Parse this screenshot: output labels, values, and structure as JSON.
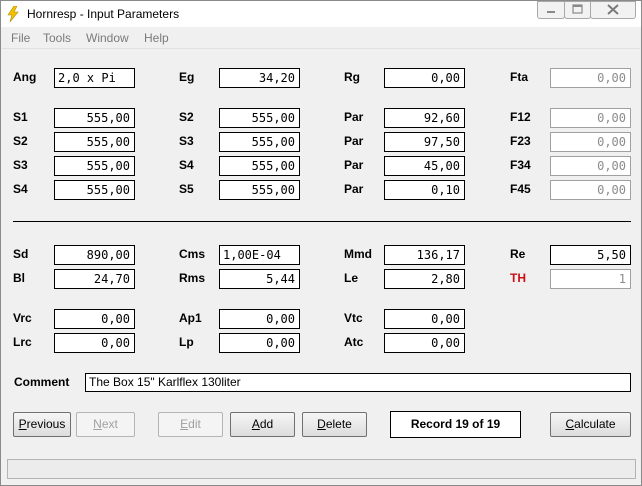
{
  "window": {
    "title": "Hornresp - Input Parameters"
  },
  "menu": [
    "File",
    "Tools",
    "Window",
    "Help"
  ],
  "params": {
    "Ang": {
      "label": "Ang",
      "value": "2,0 x Pi"
    },
    "Eg": {
      "label": "Eg",
      "value": "34,20"
    },
    "Rg": {
      "label": "Rg",
      "value": "0,00"
    },
    "Fta": {
      "label": "Fta",
      "value": "0,00"
    },
    "S1a": {
      "label": "S1",
      "value": "555,00"
    },
    "S2a": {
      "label": "S2",
      "value": "555,00"
    },
    "Par1": {
      "label": "Par",
      "value": "92,60"
    },
    "F12": {
      "label": "F12",
      "value": "0,00"
    },
    "S2b": {
      "label": "S2",
      "value": "555,00"
    },
    "S3a": {
      "label": "S3",
      "value": "555,00"
    },
    "Par2": {
      "label": "Par",
      "value": "97,50"
    },
    "F23": {
      "label": "F23",
      "value": "0,00"
    },
    "S3b": {
      "label": "S3",
      "value": "555,00"
    },
    "S4a": {
      "label": "S4",
      "value": "555,00"
    },
    "Par3": {
      "label": "Par",
      "value": "45,00"
    },
    "F34": {
      "label": "F34",
      "value": "0,00"
    },
    "S4b": {
      "label": "S4",
      "value": "555,00"
    },
    "S5": {
      "label": "S5",
      "value": "555,00"
    },
    "Par4": {
      "label": "Par",
      "value": "0,10"
    },
    "F45": {
      "label": "F45",
      "value": "0,00"
    },
    "Sd": {
      "label": "Sd",
      "value": "890,00"
    },
    "Cms": {
      "label": "Cms",
      "value": "1,00E-04"
    },
    "Mmd": {
      "label": "Mmd",
      "value": "136,17"
    },
    "Re": {
      "label": "Re",
      "value": "5,50"
    },
    "Bl": {
      "label": "Bl",
      "value": "24,70"
    },
    "Rms": {
      "label": "Rms",
      "value": "5,44"
    },
    "Le": {
      "label": "Le",
      "value": "2,80"
    },
    "TH": {
      "label": "TH",
      "value": "1"
    },
    "Vrc": {
      "label": "Vrc",
      "value": "0,00"
    },
    "Ap1": {
      "label": "Ap1",
      "value": "0,00"
    },
    "Vtc": {
      "label": "Vtc",
      "value": "0,00"
    },
    "Lrc": {
      "label": "Lrc",
      "value": "0,00"
    },
    "Lp": {
      "label": "Lp",
      "value": "0,00"
    },
    "Atc": {
      "label": "Atc",
      "value": "0,00"
    }
  },
  "comment": {
    "label": "Comment",
    "value": "The Box 15\" Karlflex 130liter"
  },
  "buttons": {
    "previous": {
      "prefix": "",
      "hot": "P",
      "rest": "revious"
    },
    "next": {
      "prefix": "",
      "hot": "N",
      "rest": "ext"
    },
    "edit": {
      "prefix": "",
      "hot": "E",
      "rest": "dit"
    },
    "add": {
      "prefix": "",
      "hot": "A",
      "rest": "dd"
    },
    "delete": {
      "prefix": "",
      "hot": "D",
      "rest": "elete"
    },
    "calculate": {
      "prefix": "",
      "hot": "C",
      "rest": "alculate"
    }
  },
  "record": "Record 19 of 19",
  "colors": {
    "th_label": "#c8101a",
    "accent_icon": "#f2c200"
  }
}
